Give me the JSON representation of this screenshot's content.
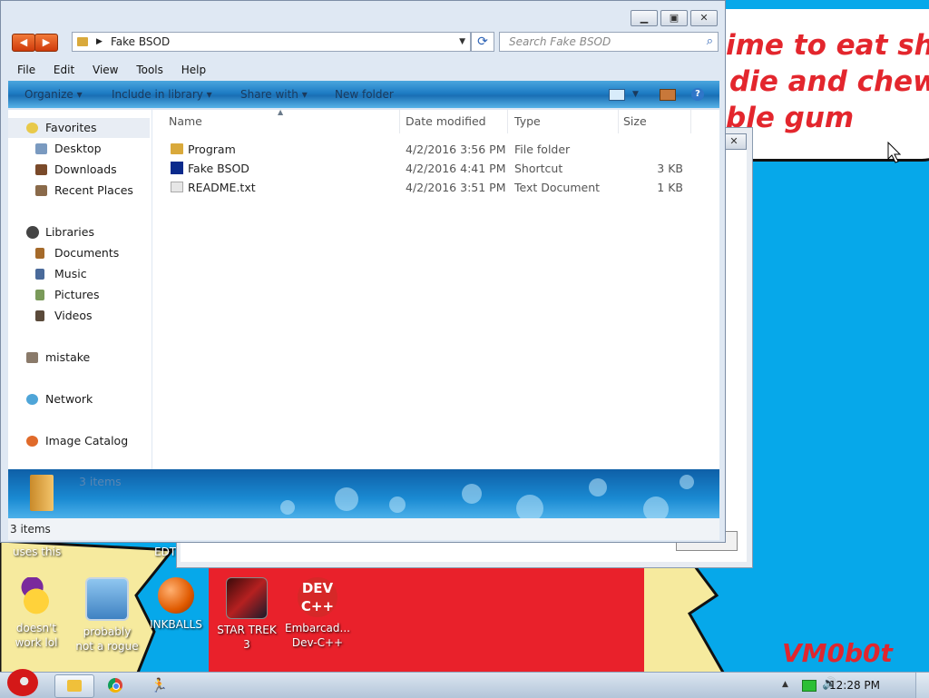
{
  "desktop": {
    "speech_text": [
      "ime to eat shit",
      "die and chew",
      "ble gum"
    ],
    "signature": "VM0b0t",
    "partial_label_left": "uses this",
    "partial_label_mid": "EDT",
    "icons": [
      {
        "name": "yahoo",
        "label_lines": [
          "doesn't",
          "work lol"
        ]
      },
      {
        "name": "rogue",
        "label_lines": [
          "probably",
          "not a rogue"
        ]
      },
      {
        "name": "inkballs",
        "label_lines": [
          "INKBALLS"
        ]
      },
      {
        "name": "star-trek",
        "label_lines": [
          "STAR TREK",
          "3"
        ]
      },
      {
        "name": "devcpp",
        "label_lines": [
          "Embarcad...",
          "Dev-C++"
        ]
      }
    ]
  },
  "window": {
    "address": "Fake BSOD",
    "search_placeholder": "Search Fake BSOD",
    "menu": [
      "File",
      "Edit",
      "View",
      "Tools",
      "Help"
    ],
    "commands": [
      "Organize",
      "Include in library",
      "Share with",
      "New folder"
    ],
    "nav": {
      "favorites": "Favorites",
      "fav_items": [
        "Desktop",
        "Downloads",
        "Recent Places"
      ],
      "libraries": "Libraries",
      "lib_items": [
        "Documents",
        "Music",
        "Pictures",
        "Videos"
      ],
      "mistake": "mistake",
      "network": "Network",
      "image_catalog": "Image Catalog"
    },
    "columns": [
      "Name",
      "Date modified",
      "Type",
      "Size"
    ],
    "files": [
      {
        "name": "Program",
        "date": "4/2/2016 3:56 PM",
        "type": "File folder",
        "size": ""
      },
      {
        "name": "Fake BSOD",
        "date": "4/2/2016 4:41 PM",
        "type": "Shortcut",
        "size": "3 KB"
      },
      {
        "name": "README.txt",
        "date": "4/2/2016 3:51 PM",
        "type": "Text Document",
        "size": "1 KB"
      }
    ],
    "details_count": "3 items",
    "status": "3 items"
  },
  "taskbar": {
    "clock": "12:28 PM"
  }
}
